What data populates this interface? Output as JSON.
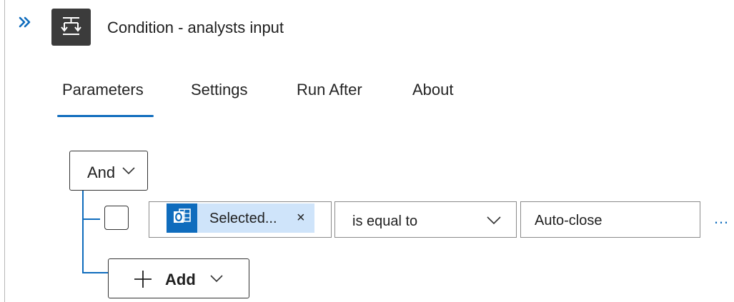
{
  "colors": {
    "accent": "#0f6cbd",
    "token_bg": "#cfe4fa",
    "icon_bg": "#3b3b3b"
  },
  "header": {
    "expand_icon": "chevron-double-right-icon",
    "action_icon": "condition-icon",
    "title": "Condition - analysts input"
  },
  "tabs": [
    {
      "label": "Parameters",
      "selected": true
    },
    {
      "label": "Settings",
      "selected": false
    },
    {
      "label": "Run After",
      "selected": false
    },
    {
      "label": "About",
      "selected": false
    }
  ],
  "condition": {
    "group_operator": "And",
    "rows": [
      {
        "checked": false,
        "token": {
          "icon": "outlook-icon",
          "label": "Selected...",
          "remove": "×"
        },
        "operator": "is equal to",
        "value": "Auto-close",
        "more": "…"
      }
    ],
    "add_label": "Add"
  }
}
